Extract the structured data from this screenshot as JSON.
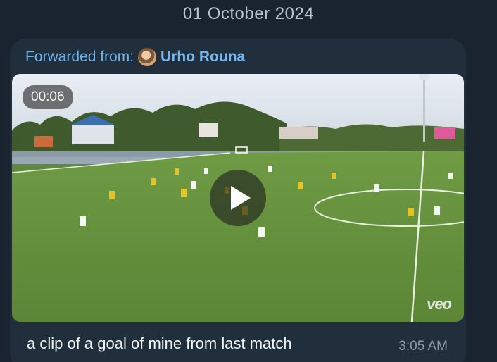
{
  "date_header": "01 October 2024",
  "message": {
    "forwarded_prefix": "Forwarded from:",
    "forwarded_name": "Urho Rouna",
    "video": {
      "duration": "00:06",
      "watermark": "veo",
      "play_icon": "play-icon"
    },
    "caption": "a clip of a goal of mine from last match",
    "time": "3:05 AM"
  },
  "colors": {
    "background": "#1a2430",
    "bubble": "#212f3d",
    "link": "#6fb3ea",
    "timestamp": "#8d99a6"
  }
}
